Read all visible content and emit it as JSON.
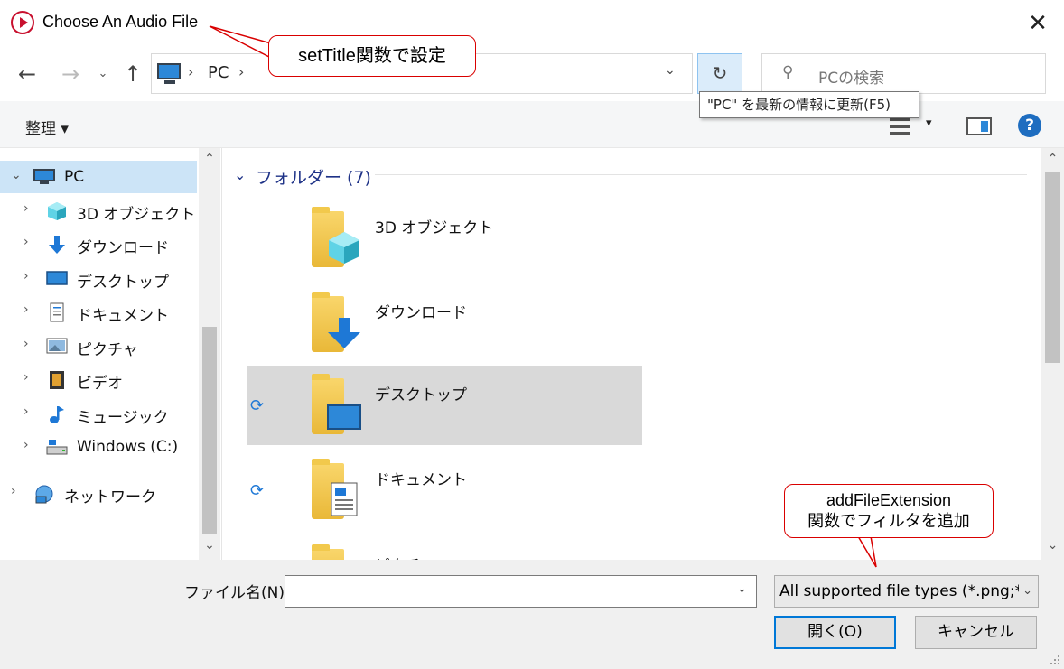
{
  "window": {
    "title": "Choose An Audio File",
    "close": "✕"
  },
  "nav": {
    "back": "←",
    "forward": "→",
    "recent": "⌄",
    "up": "↑",
    "address": {
      "separator": "›",
      "location": "PC",
      "dropdown": "⌄"
    },
    "refresh": "↻",
    "search_icon": "⚲",
    "search_placeholder": "PCの検索"
  },
  "tooltip": "\"PC\" を最新の情報に更新(F5)",
  "toolbar": {
    "organize": "整理 ▾",
    "view_dropdown": "▾",
    "help": "?"
  },
  "sidebar": {
    "scroll_up": "⌃",
    "scroll_down": "⌄",
    "items": [
      {
        "label": "PC",
        "arrow": "⌄",
        "icon": "pc-icon",
        "selected": true,
        "level": 0
      },
      {
        "label": "3D オブジェクト",
        "arrow": "›",
        "icon": "3d-objects-icon",
        "level": 1
      },
      {
        "label": "ダウンロード",
        "arrow": "›",
        "icon": "download-icon",
        "level": 1
      },
      {
        "label": "デスクトップ",
        "arrow": "›",
        "icon": "desktop-icon",
        "level": 1
      },
      {
        "label": "ドキュメント",
        "arrow": "›",
        "icon": "document-icon",
        "level": 1
      },
      {
        "label": "ピクチャ",
        "arrow": "›",
        "icon": "picture-icon",
        "level": 1
      },
      {
        "label": "ビデオ",
        "arrow": "›",
        "icon": "video-icon",
        "level": 1
      },
      {
        "label": "ミュージック",
        "arrow": "›",
        "icon": "music-icon",
        "level": 1
      },
      {
        "label": "Windows (C:)",
        "arrow": "›",
        "icon": "drive-icon",
        "level": 1
      },
      {
        "label": "ネットワーク",
        "arrow": "›",
        "icon": "network-icon",
        "level": 0
      }
    ]
  },
  "main": {
    "group_chevron": "⌄",
    "group_header": "フォルダー (7)",
    "scroll_up": "⌃",
    "scroll_down": "⌄",
    "sync_icon": "⟳",
    "folders": [
      {
        "label": "3D オブジェクト",
        "overlay": "3d-objects-icon"
      },
      {
        "label": "ダウンロード",
        "overlay": "download-arrow-icon"
      },
      {
        "label": "デスクトップ",
        "overlay": "desktop-icon",
        "selected": true,
        "synced": true
      },
      {
        "label": "ドキュメント",
        "overlay": "document-icon",
        "synced": true
      },
      {
        "label": "ピクチャ",
        "overlay": "picture-icon"
      }
    ]
  },
  "bottom": {
    "filename_label": "ファイル名(N):",
    "filename_value": "",
    "filename_dropdown": "⌄",
    "filetype_value": "All supported file types (*.png;*",
    "filetype_arrow": "⌄",
    "open": "開く(O)",
    "cancel": "キャンセル"
  },
  "callouts": {
    "title_note": "setTitle関数で設定",
    "filter_note_line1": "addFileExtension",
    "filter_note_line2": "関数でフィルタを追加"
  },
  "colors": {
    "accent": "#0078d7",
    "callout_border": "#d90000",
    "group_header": "#1e3287",
    "selection": "#cce4f7"
  }
}
